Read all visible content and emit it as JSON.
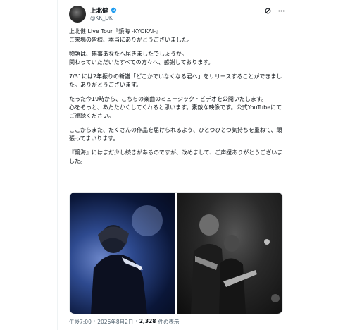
{
  "post": {
    "display_name": "上北健",
    "handle": "@KK_DK",
    "paragraphs": [
      "上北健 Live Tour『鏡海 -KYOKAI-』\nご来場の皆様、本当にありがとうございました。",
      "物語は、無事あなたへ届きましたでしょうか。\n関わっていただいたすべての方々へ、感謝しております。",
      "7/31には2年振りの新譜「どこかでいなくなる君へ」をリリースすることができました。ありがとうございます。",
      "たった今19時から、こちらの楽曲のミュージック・ビデオを公開いたします。\n心をそっと、あたたかくしてくれると思います。素敵な映像です。公式YouTubeにてご視聴ください。",
      "ここからまた、たくさんの作品を届けられるよう、ひとつひとつ気持ちを重ねて、頑張ってまいります。",
      "『鏡海』にはまだ少し続きがあるのですが、改めまして、ご声援ありがとうございました。"
    ],
    "time": "午後7:00",
    "separator": "·",
    "date": "2026年8月2日",
    "views": "2,328",
    "views_label": "件の表示"
  },
  "icons": {
    "verified": "verified-badge-icon",
    "grok": "grok-icon",
    "more": "more-icon"
  },
  "colors": {
    "verified": "#1d9bf0",
    "secondary_text": "#536471"
  }
}
